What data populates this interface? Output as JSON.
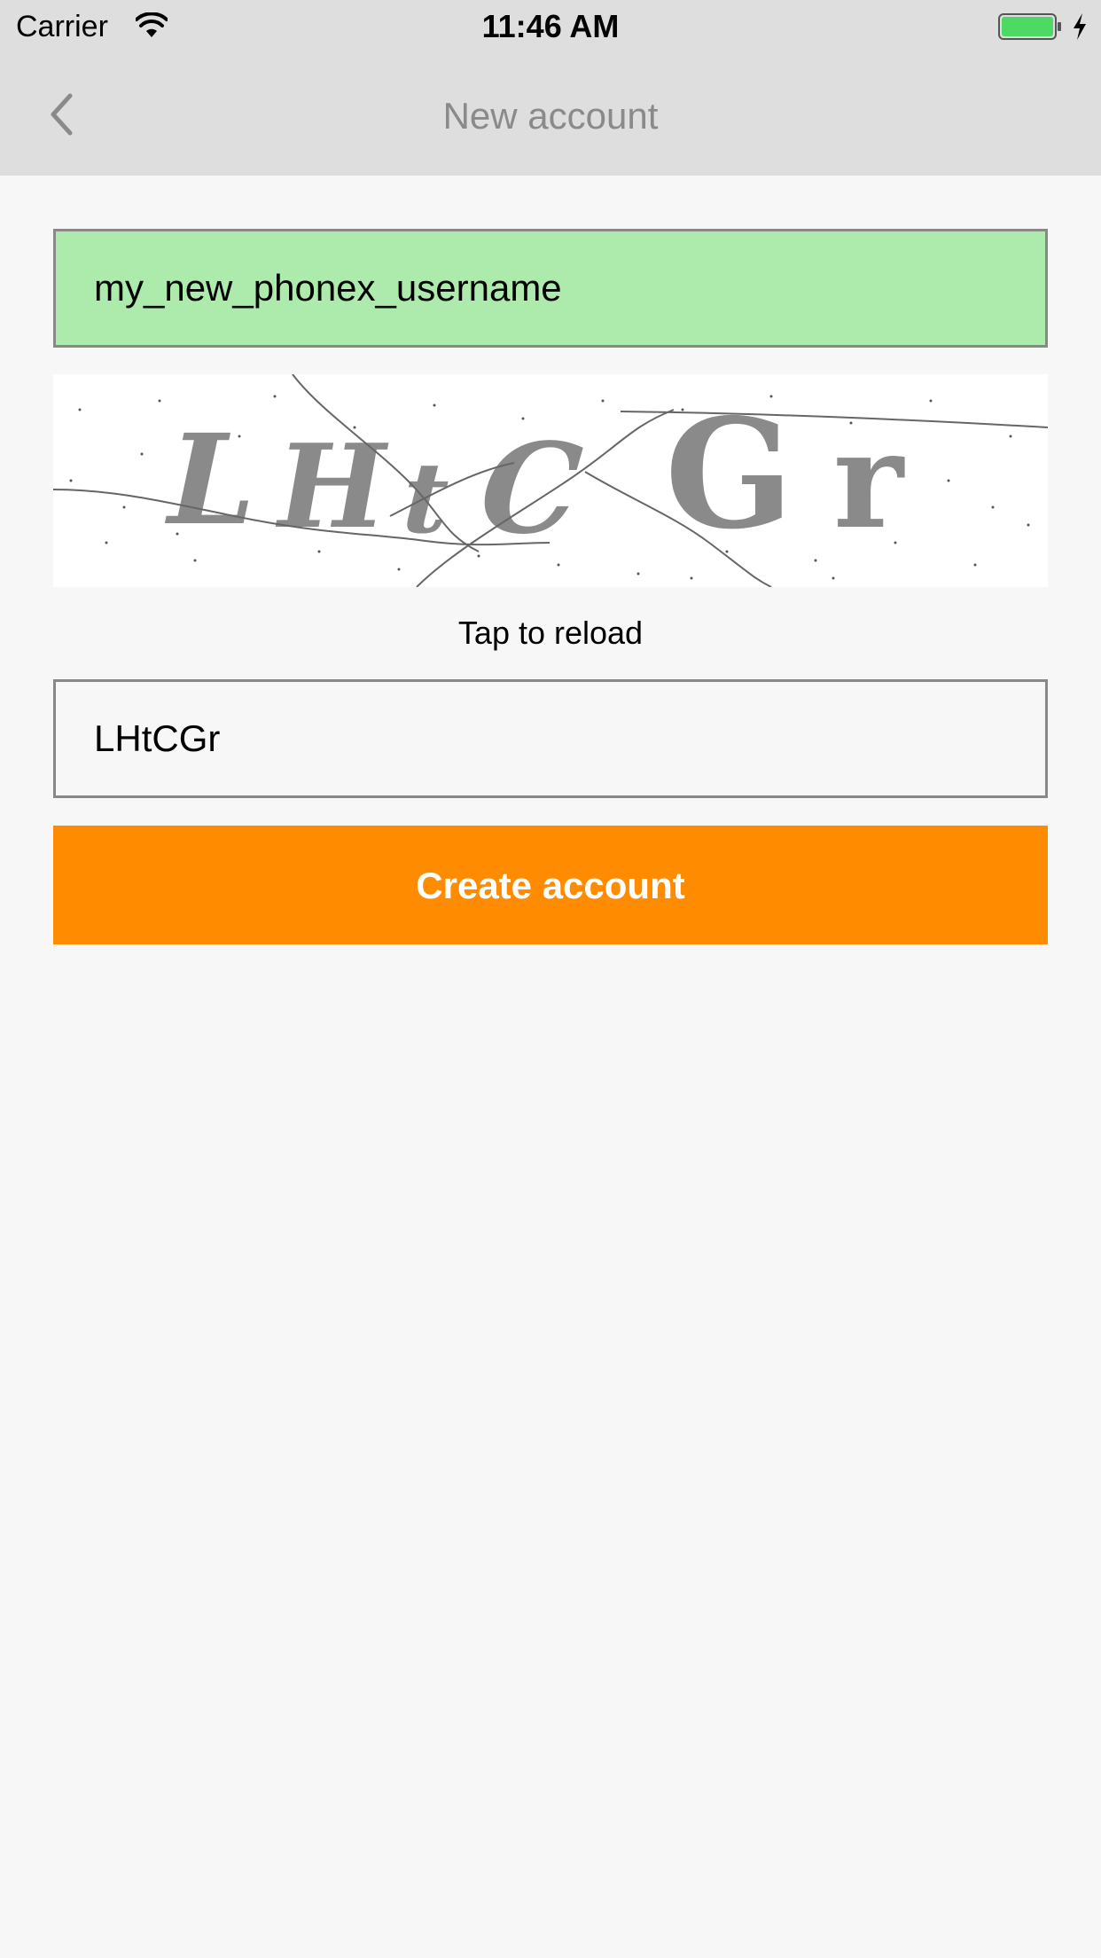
{
  "status_bar": {
    "carrier": "Carrier",
    "time": "11:46 AM",
    "battery_color": "#4cd964"
  },
  "nav": {
    "title": "New account",
    "back_icon": "chevron-left-icon"
  },
  "form": {
    "username_value": "my_new_phonex_username",
    "username_bg": "#acebac",
    "captcha_text": "LHtCGr",
    "reload_label": "Tap to reload",
    "captcha_value": "LHtCGr",
    "submit_label": "Create account",
    "accent_color": "#ff8c00"
  }
}
